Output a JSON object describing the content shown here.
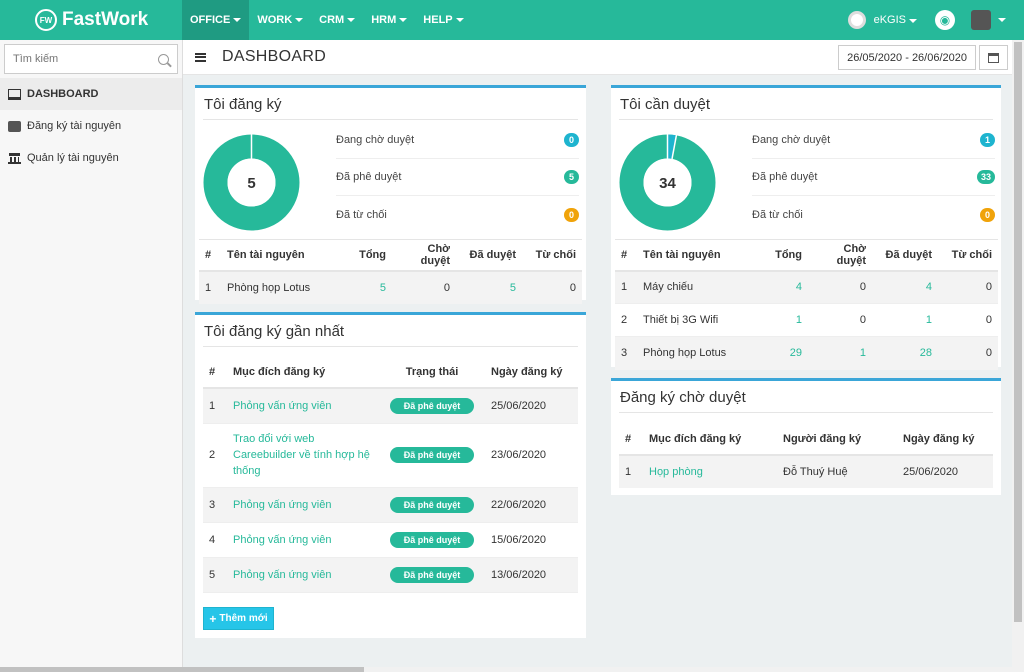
{
  "brand": {
    "name": "FastWork",
    "logo_text": "FW"
  },
  "nav": [
    {
      "label": "OFFICE",
      "active": true
    },
    {
      "label": "WORK",
      "active": false
    },
    {
      "label": "CRM",
      "active": false
    },
    {
      "label": "HRM",
      "active": false
    },
    {
      "label": "HELP",
      "active": false
    }
  ],
  "user": {
    "org": "eKGIS"
  },
  "sidebar": {
    "search_placeholder": "Tìm kiếm",
    "items": [
      {
        "label": "DASHBOARD",
        "icon": "monitor-icon",
        "active": true
      },
      {
        "label": "Đăng ký tài nguyên",
        "icon": "cubes-icon",
        "active": false
      },
      {
        "label": "Quản lý tài nguyên",
        "icon": "bank-icon",
        "active": false
      }
    ]
  },
  "header": {
    "title": "DASHBOARD",
    "date_range": "26/05/2020 - 26/06/2020"
  },
  "my_registrations": {
    "title": "Tôi đăng ký",
    "total": "5",
    "stats": [
      {
        "label": "Đang chờ duyệt",
        "count": "0",
        "color": "#1eb4cf"
      },
      {
        "label": "Đã phê duyệt",
        "count": "5",
        "color": "#26b99a"
      },
      {
        "label": "Đã từ chối",
        "count": "0",
        "color": "#f0a30a"
      }
    ],
    "columns": [
      "#",
      "Tên tài nguyên",
      "Tổng",
      "Chờ duyệt",
      "Đã duyệt",
      "Từ chối"
    ],
    "rows": [
      [
        "1",
        "Phòng họp Lotus",
        "5",
        "0",
        "5",
        "0"
      ]
    ]
  },
  "to_approve": {
    "title": "Tôi cần duyệt",
    "total": "34",
    "stats": [
      {
        "label": "Đang chờ duyệt",
        "count": "1",
        "color": "#1eb4cf"
      },
      {
        "label": "Đã phê duyệt",
        "count": "33",
        "color": "#26b99a"
      },
      {
        "label": "Đã từ chối",
        "count": "0",
        "color": "#f0a30a"
      }
    ],
    "columns": [
      "#",
      "Tên tài nguyên",
      "Tổng",
      "Chờ duyệt",
      "Đã duyệt",
      "Từ chối"
    ],
    "rows": [
      [
        "1",
        "Máy chiếu",
        "4",
        "0",
        "4",
        "0"
      ],
      [
        "2",
        "Thiết bị 3G Wifi",
        "1",
        "0",
        "1",
        "0"
      ],
      [
        "3",
        "Phòng họp Lotus",
        "29",
        "1",
        "28",
        "0"
      ]
    ]
  },
  "recent": {
    "title": "Tôi đăng ký gần nhất",
    "columns": [
      "#",
      "Mục đích đăng ký",
      "Trạng thái",
      "Ngày đăng ký"
    ],
    "rows": [
      [
        "1",
        "Phỏng vấn ứng viên",
        "Đã phê duyệt",
        "25/06/2020"
      ],
      [
        "2",
        "Trao đổi với web Careebuilder về tính hợp hệ thống",
        "Đã phê duyệt",
        "23/06/2020"
      ],
      [
        "3",
        "Phỏng vấn ứng viên",
        "Đã phê duyệt",
        "22/06/2020"
      ],
      [
        "4",
        "Phỏng vấn ứng viên",
        "Đã phê duyệt",
        "15/06/2020"
      ],
      [
        "5",
        "Phỏng vấn ứng viên",
        "Đã phê duyệt",
        "13/06/2020"
      ]
    ],
    "add_label": "Thêm mới"
  },
  "pending": {
    "title": "Đăng ký chờ duyệt",
    "columns": [
      "#",
      "Mục đích đăng ký",
      "Người đăng ký",
      "Ngày đăng ký"
    ],
    "rows": [
      [
        "1",
        "Họp phòng",
        "Đỗ Thuý Huệ",
        "25/06/2020"
      ]
    ]
  }
}
